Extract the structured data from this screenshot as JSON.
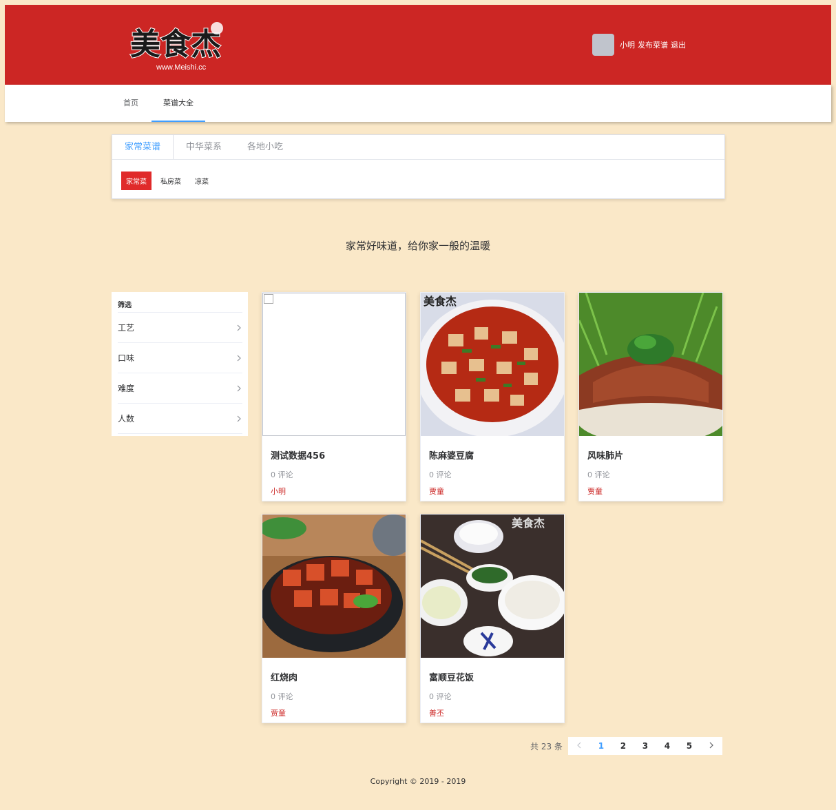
{
  "header": {
    "logo_text": "美食杰",
    "logo_url_text": "www.Meishi.cc",
    "username": "小明",
    "publish_label": "发布菜谱",
    "logout_label": "退出"
  },
  "nav": {
    "items": [
      {
        "label": "首页",
        "active": false
      },
      {
        "label": "菜谱大全",
        "active": true
      }
    ]
  },
  "category": {
    "tabs": [
      {
        "label": "家常菜谱",
        "active": true
      },
      {
        "label": "中华菜系",
        "active": false
      },
      {
        "label": "各地小吃",
        "active": false
      }
    ],
    "tags": [
      {
        "label": "家常菜",
        "active": true
      },
      {
        "label": "私房菜",
        "active": false
      },
      {
        "label": "凉菜",
        "active": false
      }
    ]
  },
  "slogan": "家常好味道，给你家一般的温暖",
  "filter": {
    "title": "筛选",
    "items": [
      "工艺",
      "口味",
      "难度",
      "人数"
    ]
  },
  "recipes": [
    {
      "title": "测试数据456",
      "comments": "0 评论",
      "author": "小明",
      "image": "broken"
    },
    {
      "title": "陈麻婆豆腐",
      "comments": "0 评论",
      "author": "贾童",
      "image": "tofu"
    },
    {
      "title": "风味肺片",
      "comments": "0 评论",
      "author": "贾童",
      "image": "feipian"
    },
    {
      "title": "红烧肉",
      "comments": "0 评论",
      "author": "贾童",
      "image": "hongshaorou"
    },
    {
      "title": "富顺豆花饭",
      "comments": "0 评论",
      "author": "善丕",
      "image": "douhua"
    }
  ],
  "pagination": {
    "total_text": "共 23 条",
    "pages": [
      "1",
      "2",
      "3",
      "4",
      "5"
    ],
    "current": "1"
  },
  "footer": {
    "copyright": "Copyright © 2019 - 2019"
  },
  "colors": {
    "background": "#fae8c8",
    "header": "#cc2624",
    "accent": "#409eff",
    "tag_active": "#e02a2a"
  }
}
